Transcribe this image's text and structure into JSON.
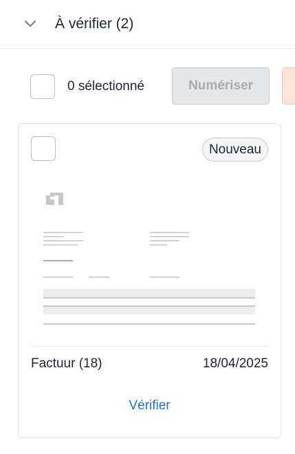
{
  "section": {
    "title": "À vérifier (2)",
    "collapse_icon": "chevron-down-icon"
  },
  "toolbar": {
    "selected_label": "0 sélectionné",
    "scan_button_label": "Numériser",
    "scan_button_enabled": false
  },
  "card": {
    "badge": "Nouveau",
    "document_name": "Factuur (18)",
    "document_date": "18/04/2025",
    "verify_label": "Vérifier",
    "thumbnail_icon": "invoice-thumbnail"
  },
  "colors": {
    "link": "#1a73d9",
    "disabled_button_bg": "#e5e6e8",
    "delete_button_bg": "#fde3d8",
    "text": "#1d2433"
  }
}
